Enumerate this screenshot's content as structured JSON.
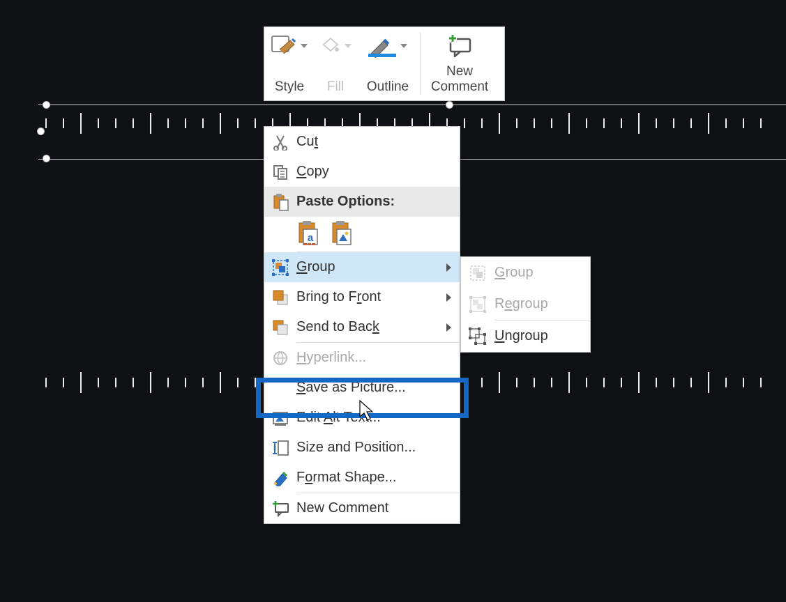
{
  "mini_toolbar": {
    "style": "Style",
    "fill": "Fill",
    "outline": "Outline",
    "new_comment_line1": "New",
    "new_comment_line2": "Comment"
  },
  "context_menu": {
    "cut": "Cut",
    "copy": "Copy",
    "paste_options": "Paste Options:",
    "group": "Group",
    "bring_to_front": "Bring to Front",
    "send_to_back": "Send to Back",
    "hyperlink": "Hyperlink...",
    "save_as_picture": "Save as Picture...",
    "edit_alt_text": "Edit Alt Text...",
    "size_and_position": "Size and Position...",
    "format_shape": "Format Shape...",
    "new_comment": "New Comment",
    "accel": {
      "cut": "t",
      "copy": "C",
      "group": "G",
      "bring_front": "r",
      "send_back": "k",
      "hyperlink": "H",
      "save_pic": "S",
      "alt_text": "A",
      "format_shape": "o"
    }
  },
  "submenu": {
    "group": "Group",
    "regroup": "Regroup",
    "ungroup": "Ungroup"
  },
  "colors": {
    "highlight_border": "#1467c2",
    "accent_blue": "#1f8ae0",
    "icon_orange": "#d88a2b"
  }
}
